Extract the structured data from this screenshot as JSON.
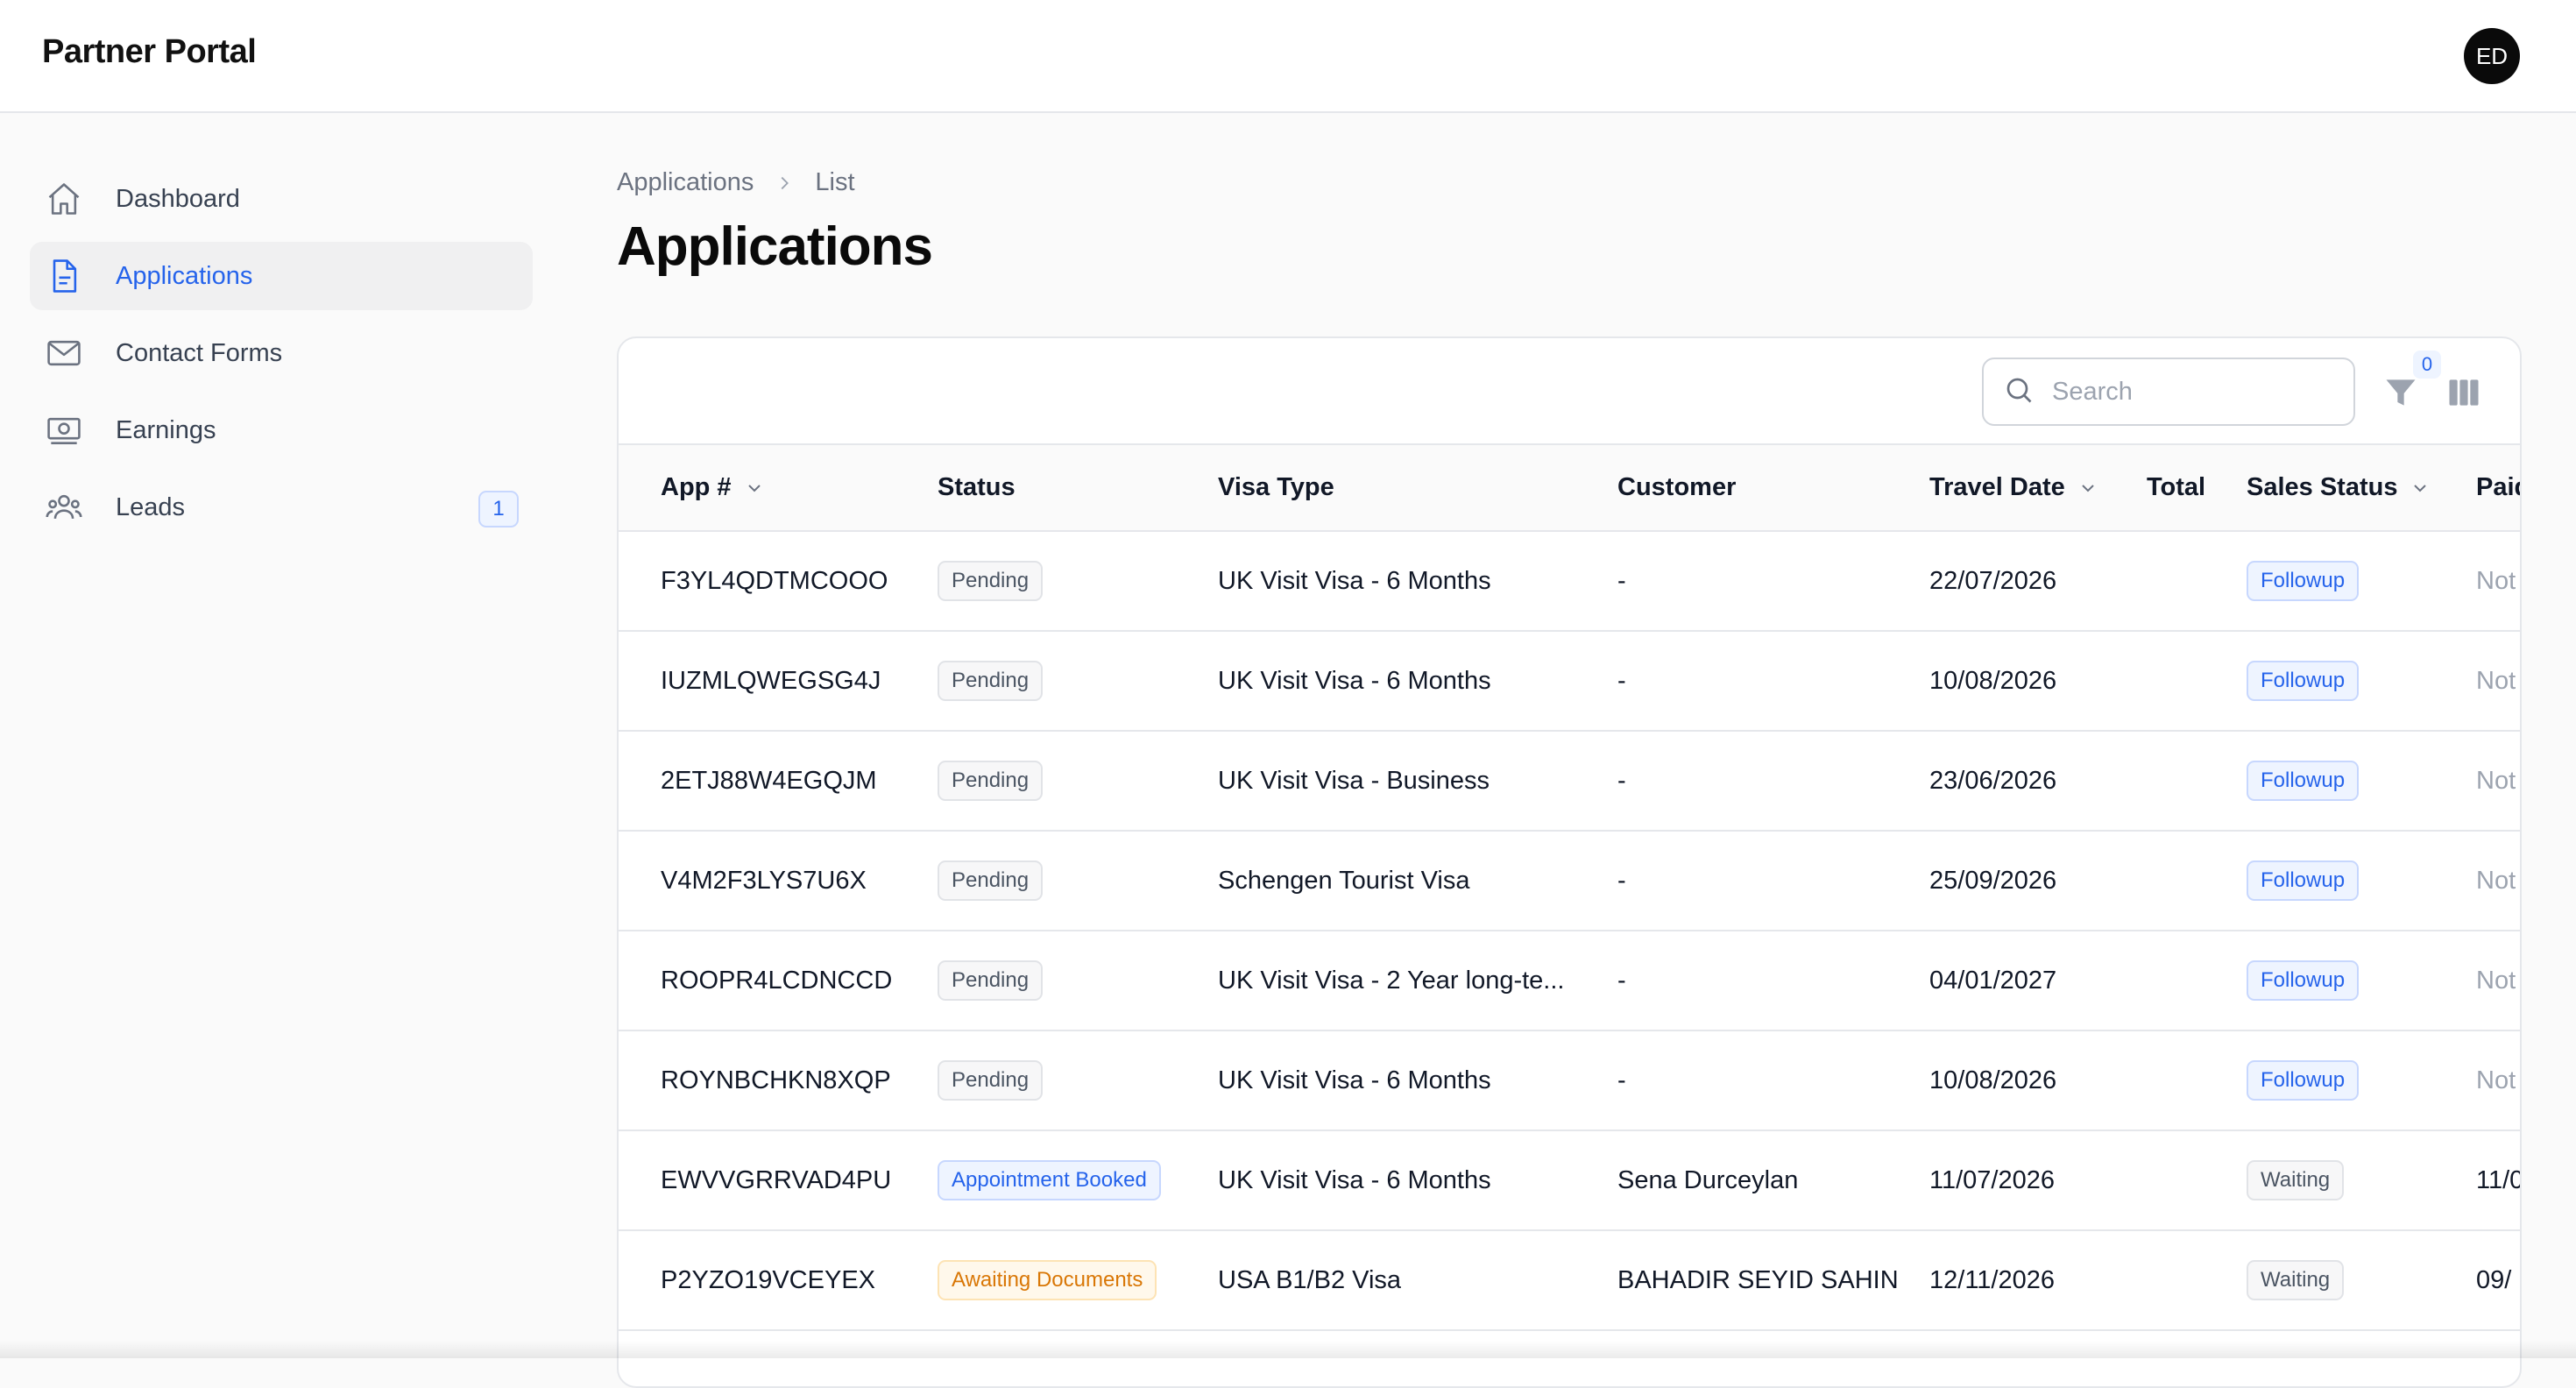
{
  "app": {
    "title": "Partner Portal",
    "avatar_initials": "ED"
  },
  "sidebar": {
    "items": [
      {
        "label": "Dashboard",
        "icon": "home-icon",
        "active": false
      },
      {
        "label": "Applications",
        "icon": "document-icon",
        "active": true
      },
      {
        "label": "Contact Forms",
        "icon": "envelope-icon",
        "active": false
      },
      {
        "label": "Earnings",
        "icon": "banknote-icon",
        "active": false
      },
      {
        "label": "Leads",
        "icon": "users-icon",
        "active": false,
        "badge": "1"
      }
    ]
  },
  "breadcrumb": {
    "parent": "Applications",
    "current": "List"
  },
  "page": {
    "title": "Applications"
  },
  "toolbar": {
    "search_placeholder": "Search",
    "filter_count": "0"
  },
  "table": {
    "columns": [
      "App #",
      "Status",
      "Visa Type",
      "Customer",
      "Travel Date",
      "Total",
      "Sales Status",
      "Paid"
    ],
    "rows": [
      {
        "app": "F3YL4QDTMCOOO",
        "status": "Pending",
        "status_tone": "gray",
        "visa": "UK Visit Visa - 6 Months",
        "customer": "-",
        "travel": "22/07/2026",
        "total": "",
        "sales": "Followup",
        "sales_tone": "blue",
        "paid": "Not"
      },
      {
        "app": "IUZMLQWEGSG4J",
        "status": "Pending",
        "status_tone": "gray",
        "visa": "UK Visit Visa - 6 Months",
        "customer": "-",
        "travel": "10/08/2026",
        "total": "",
        "sales": "Followup",
        "sales_tone": "blue",
        "paid": "Not"
      },
      {
        "app": "2ETJ88W4EGQJM",
        "status": "Pending",
        "status_tone": "gray",
        "visa": "UK Visit Visa - Business",
        "customer": "-",
        "travel": "23/06/2026",
        "total": "",
        "sales": "Followup",
        "sales_tone": "blue",
        "paid": "Not"
      },
      {
        "app": "V4M2F3LYS7U6X",
        "status": "Pending",
        "status_tone": "gray",
        "visa": "Schengen Tourist Visa",
        "customer": "-",
        "travel": "25/09/2026",
        "total": "",
        "sales": "Followup",
        "sales_tone": "blue",
        "paid": "Not"
      },
      {
        "app": "ROOPR4LCDNCCD",
        "status": "Pending",
        "status_tone": "gray",
        "visa": "UK Visit Visa - 2 Year long-te...",
        "customer": "-",
        "travel": "04/01/2027",
        "total": "",
        "sales": "Followup",
        "sales_tone": "blue",
        "paid": "Not"
      },
      {
        "app": "ROYNBCHKN8XQP",
        "status": "Pending",
        "status_tone": "gray",
        "visa": "UK Visit Visa - 6 Months",
        "customer": "-",
        "travel": "10/08/2026",
        "total": "",
        "sales": "Followup",
        "sales_tone": "blue",
        "paid": "Not"
      },
      {
        "app": "EWVVGRRVAD4PU",
        "status": "Appointment Booked",
        "status_tone": "blue",
        "visa": "UK Visit Visa - 6 Months",
        "customer": "Sena Durceylan",
        "travel": "11/07/2026",
        "total": "",
        "sales": "Waiting",
        "sales_tone": "gray",
        "paid": "11/0"
      },
      {
        "app": "P2YZO19VCEYEX",
        "status": "Awaiting Documents",
        "status_tone": "amber",
        "visa": "USA B1/B2 Visa",
        "customer": "BAHADIR SEYID SAHIN",
        "travel": "12/11/2026",
        "total": "",
        "sales": "Waiting",
        "sales_tone": "gray",
        "paid": "09/"
      }
    ]
  },
  "colors": {
    "accent": "#2563eb",
    "muted": "#9ca3af",
    "border": "#e5e7eb"
  }
}
